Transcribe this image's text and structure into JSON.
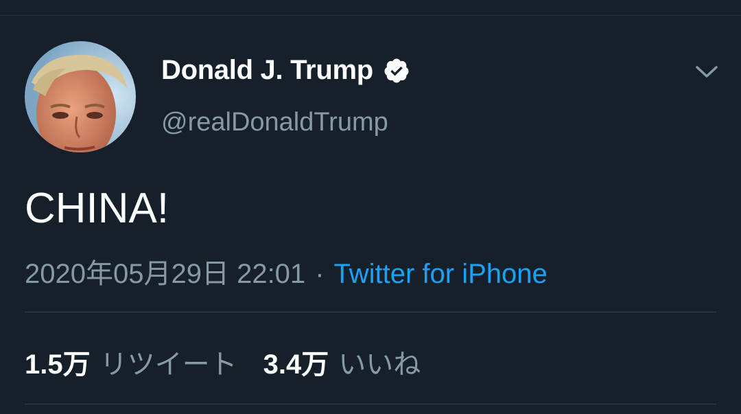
{
  "tweet": {
    "author": {
      "display_name": "Donald J. Trump",
      "handle": "@realDonaldTrump",
      "verified": true
    },
    "text": "CHINA!",
    "timestamp": "2020年05月29日 22:01",
    "separator": "·",
    "source": "Twitter for iPhone",
    "stats": {
      "retweets_count": "1.5万",
      "retweets_label": "リツイート",
      "likes_count": "3.4万",
      "likes_label": "いいね"
    }
  },
  "icons": {
    "verified": "verified-badge-icon",
    "menu": "chevron-down-icon"
  },
  "colors": {
    "background": "#15202b",
    "text_primary": "#ffffff",
    "text_secondary": "#8899a6",
    "accent": "#1da1f2",
    "divider": "#38444d"
  }
}
